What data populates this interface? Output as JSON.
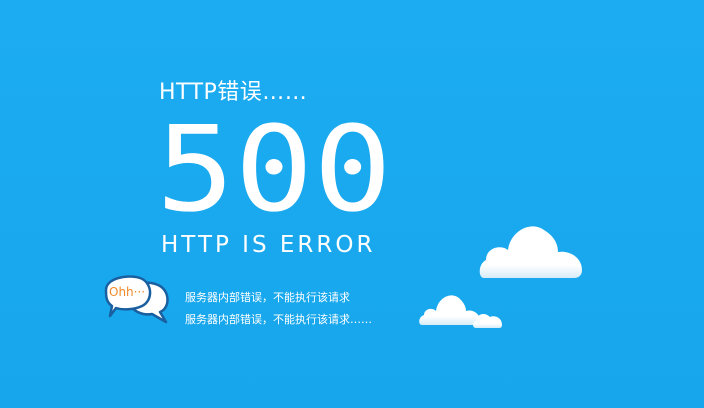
{
  "header": {
    "subtitle": "HTTP错误……"
  },
  "main": {
    "code": "500",
    "label": "HTTP IS ERROR"
  },
  "speech_bubble": {
    "text": "Ohh···"
  },
  "messages": [
    "服务器内部错误，不能执行该请求",
    "服务器内部错误，不能执行该请求……"
  ],
  "colors": {
    "background": "#1aaaf0",
    "text": "#ffffff",
    "accent": "#f0892a"
  },
  "icons": [
    "speech-bubbles-icon",
    "cloud-icon"
  ]
}
